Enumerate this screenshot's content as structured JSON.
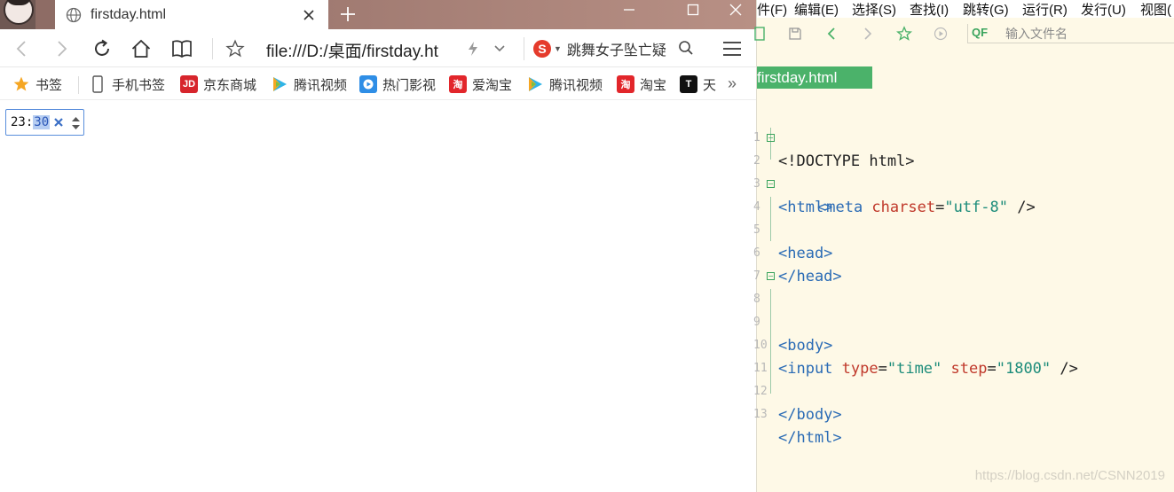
{
  "browser": {
    "tab_title": "firstday.html",
    "url": "file:///D:/桌面/firstday.ht",
    "search_text": "跳舞女子坠亡疑",
    "search_logo": "S",
    "bookmarks": [
      {
        "label": "书签",
        "icon": "star-icon"
      },
      {
        "label": "手机书签",
        "icon": "phone-icon"
      },
      {
        "label": "京东商城",
        "icon": "jd-icon",
        "icon_text": "JD",
        "color": "#d7252c"
      },
      {
        "label": "腾讯视频",
        "icon": "play-icon"
      },
      {
        "label": "热门影视",
        "icon": "video-icon"
      },
      {
        "label": "爱淘宝",
        "icon": "taobao-icon",
        "icon_text": "淘",
        "color": "#e2262b"
      },
      {
        "label": "腾讯视频",
        "icon": "play-icon"
      },
      {
        "label": "淘宝",
        "icon": "taobao-icon",
        "icon_text": "淘",
        "color": "#e2262b"
      },
      {
        "label": "天",
        "icon": "tmall-icon",
        "icon_text": "T",
        "color": "#111111"
      }
    ],
    "more_bookmarks": "»",
    "time_input": {
      "hour": "23",
      "separator": ":",
      "minute": "30"
    }
  },
  "editor": {
    "menu": [
      "件(F)",
      "编辑(E)",
      "选择(S)",
      "查找(I)",
      "跳转(G)",
      "运行(R)",
      "发行(U)",
      "视图("
    ],
    "file_search_placeholder": "输入文件名",
    "file_search_prefix": "QF",
    "file_tab": "firstday.html",
    "line_numbers": [
      "1",
      "2",
      "3",
      "4",
      "5",
      "6",
      "7",
      "8",
      "9",
      "10",
      "11",
      "12",
      "13"
    ],
    "code": {
      "l1": "<!DOCTYPE html>",
      "l2_tag": "<html>",
      "l3_open": "<meta ",
      "l3_attr": "charset",
      "l3_eq": "=",
      "l3_val": "\"utf-8\"",
      "l3_close": " />",
      "l4_tag": "<head>",
      "l6_tag": "</head>",
      "l8_tag": "<body>",
      "l10_open": "<input ",
      "l10_attr1": "type",
      "l10_eq": "=",
      "l10_val1": "\"time\"",
      "l10_attr2": "step",
      "l10_val2": "\"1800\"",
      "l10_close": " />",
      "l12_tag": "</body>",
      "l13_tag": "</html>"
    },
    "watermark": "https://blog.csdn.net/CSNN2019"
  },
  "colors": {
    "accent_green": "#4bb26a",
    "tag_blue": "#2a6bb5",
    "attr_red": "#c0392b",
    "value_teal": "#1c8c7a"
  }
}
